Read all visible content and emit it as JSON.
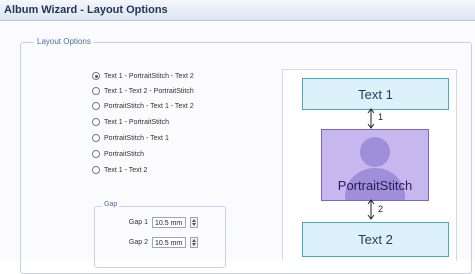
{
  "window": {
    "title": "Album Wizard - Layout Options"
  },
  "group": {
    "legend": "Layout Options"
  },
  "layout_options": [
    {
      "label": "Text 1 - PortraitStitch - Text 2",
      "selected": true
    },
    {
      "label": "Text 1 - Text 2 - PortraitStitch",
      "selected": false
    },
    {
      "label": "PortraitStitch - Text 1 - Text 2",
      "selected": false
    },
    {
      "label": "Text 1 - PortraitStitch",
      "selected": false
    },
    {
      "label": "PortraitStitch - Text 1",
      "selected": false
    },
    {
      "label": "PortraitStitch",
      "selected": false
    },
    {
      "label": "Text 1 - Text 2",
      "selected": false
    }
  ],
  "gap": {
    "legend": "Gap",
    "gap1": {
      "label": "Gap 1",
      "value": "10.5 mm"
    },
    "gap2": {
      "label": "Gap 2",
      "value": "10.5 mm"
    }
  },
  "preview": {
    "text1": "Text 1",
    "portrait": "PortraitStitch",
    "text2": "Text 2",
    "marker1": "1",
    "marker2": "2"
  },
  "colors": {
    "text_box_fill": "#dcf1f9",
    "text_box_border": "#4aa5c7",
    "portrait_fill": "#c6b8ee",
    "portrait_silhouette": "#9f8fdb"
  }
}
